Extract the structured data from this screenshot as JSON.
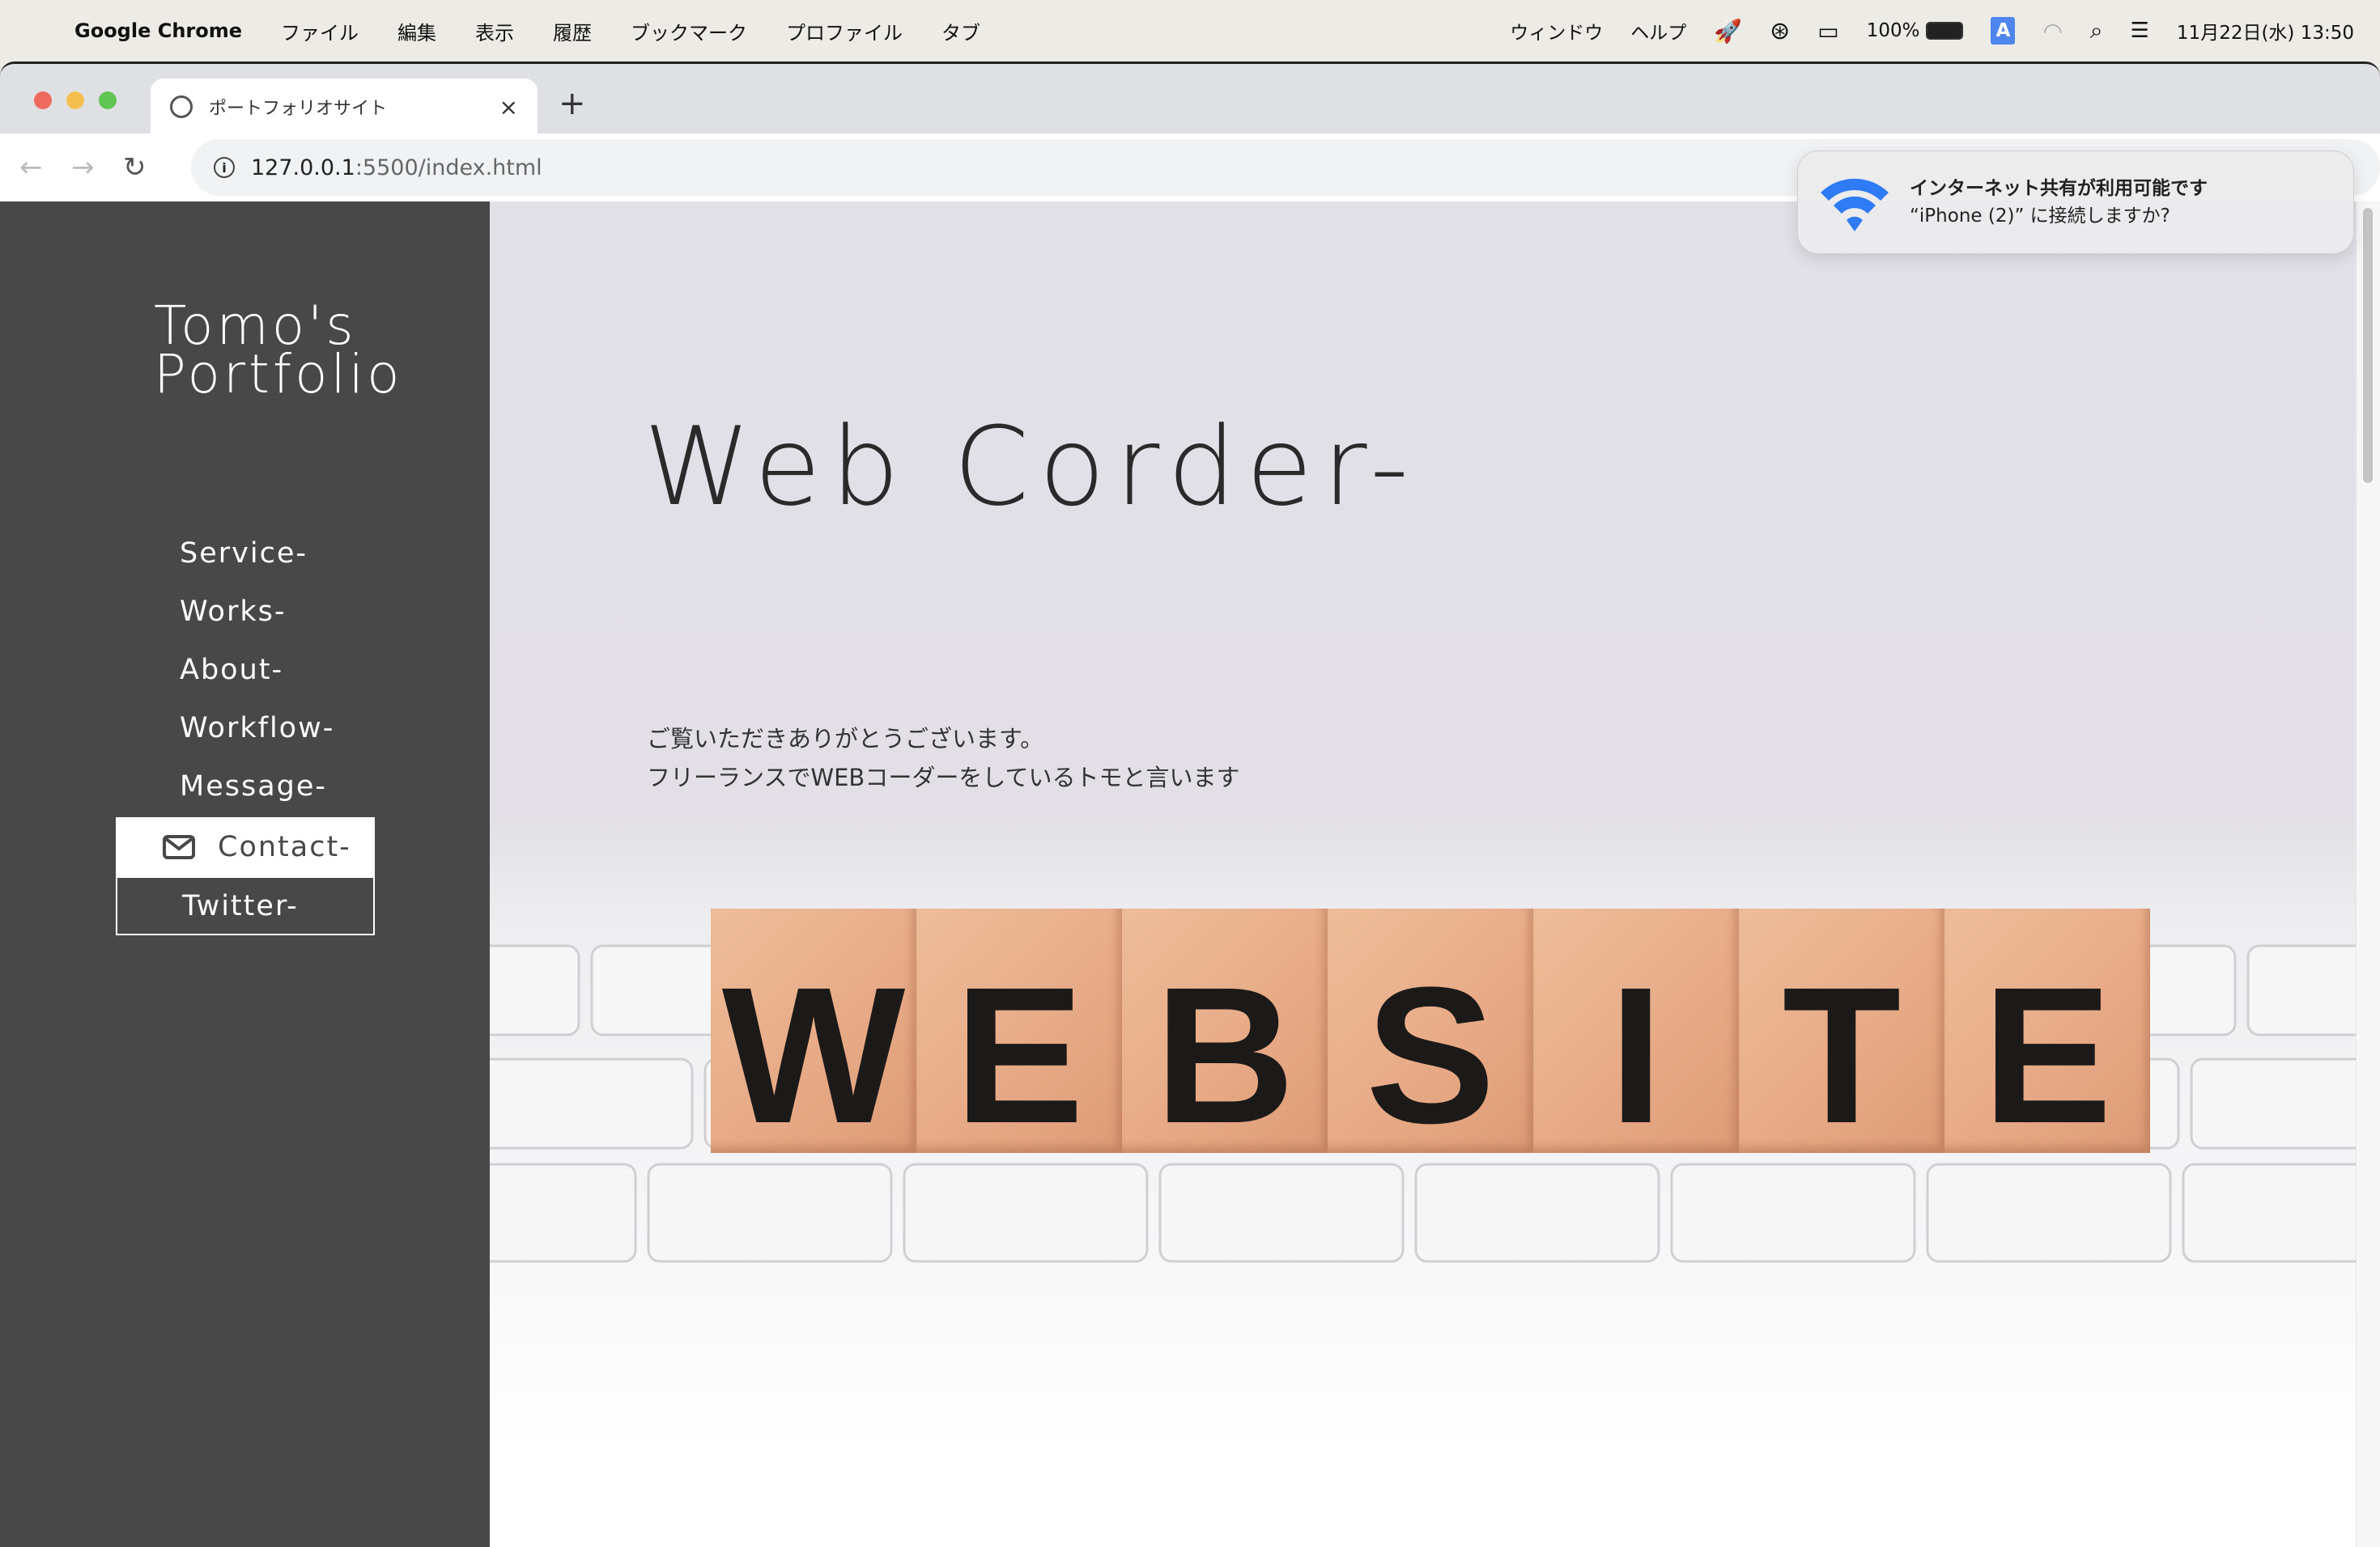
{
  "menubar": {
    "app": "Google Chrome",
    "items": [
      "ファイル",
      "編集",
      "表示",
      "履歴",
      "ブックマーク",
      "プロファイル",
      "タブ",
      "ウィンドウ",
      "ヘルプ"
    ],
    "battery": "100%",
    "input_badge": "A",
    "datetime": "11月22日(水)  13:50"
  },
  "browser": {
    "tab_title": "ポートフォリオサイト",
    "url_host": "127.0.0.1",
    "url_path": ":5500/index.html"
  },
  "notification": {
    "title": "インターネット共有が利用可能です",
    "body": "“iPhone (2)” に接続しますか?",
    "icon_color": "#2f7bf5"
  },
  "sidebar": {
    "logo_line1": "Tomo's",
    "logo_line2": "Portfolio",
    "items": [
      "Service-",
      "Works-",
      "About-",
      "Workflow-",
      "Message-"
    ],
    "contact": "Contact-",
    "twitter": "Twitter-",
    "bg": "#484848"
  },
  "hero": {
    "title": "Web Corder-",
    "line1": "ご覧いただきありがとうございます。",
    "line2": "フリーランスでWEBコーダーをしているトモと言います",
    "blocks": [
      "W",
      "E",
      "B",
      "S",
      "I",
      "T",
      "E"
    ]
  }
}
